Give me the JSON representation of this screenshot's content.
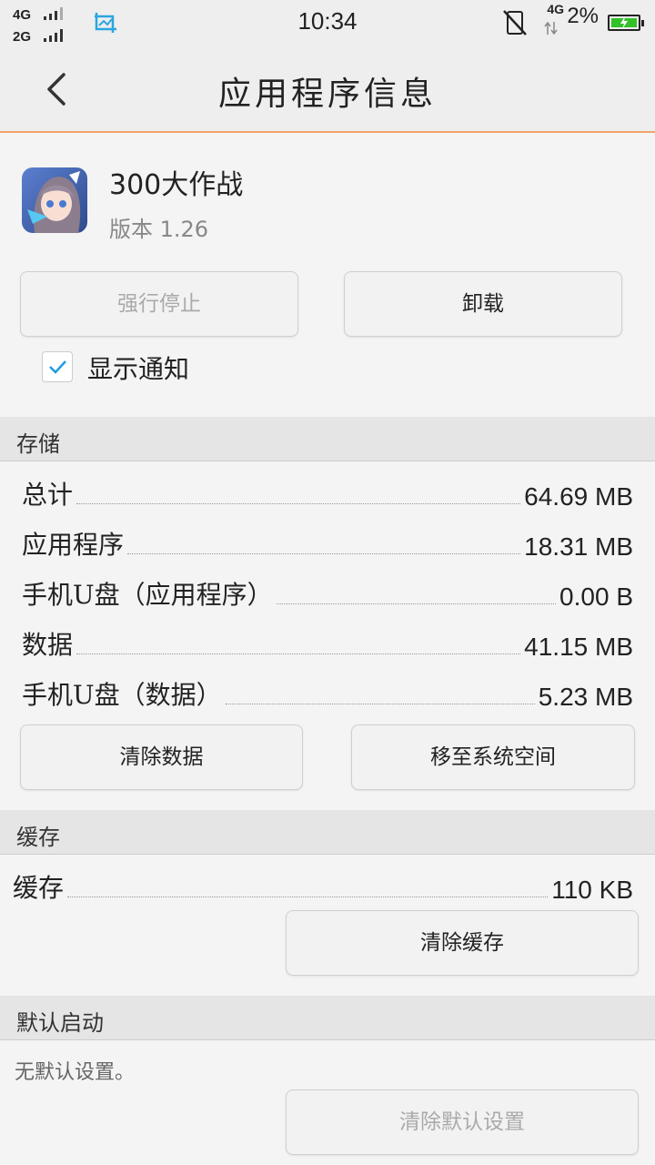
{
  "status_bar": {
    "net1": "4G",
    "net2": "2G",
    "time": "10:34",
    "net_right": "4G",
    "battery_pct": "2%",
    "battery_level": 0.02,
    "icons": [
      "screenshot-icon",
      "mute-icon",
      "battery-icon"
    ]
  },
  "header": {
    "title": "应用程序信息"
  },
  "app": {
    "name": "300大作战",
    "version": "版本 1.26"
  },
  "actions": {
    "force_stop": "强行停止",
    "uninstall": "卸载"
  },
  "notification": {
    "label": "显示通知",
    "checked": true
  },
  "storage": {
    "title": "存储",
    "rows": [
      {
        "label": "总计",
        "value": "64.69 MB"
      },
      {
        "label": "应用程序",
        "value": "18.31 MB"
      },
      {
        "label": "手机U盘（应用程序）",
        "value": "0.00 B"
      },
      {
        "label": "数据",
        "value": "41.15 MB"
      },
      {
        "label": "手机U盘（数据）",
        "value": "5.23 MB"
      }
    ],
    "clear_data": "清除数据",
    "move_to_system": "移至系统空间"
  },
  "cache": {
    "title": "缓存",
    "row": {
      "label": "缓存",
      "value": "110 KB"
    },
    "clear_cache": "清除缓存"
  },
  "default_launch": {
    "title": "默认启动",
    "note": "无默认设置。",
    "clear_defaults": "清除默认设置"
  },
  "colors": {
    "accent_line": "#f0a46a",
    "check": "#1e9be0",
    "battery": "#33c12a"
  }
}
